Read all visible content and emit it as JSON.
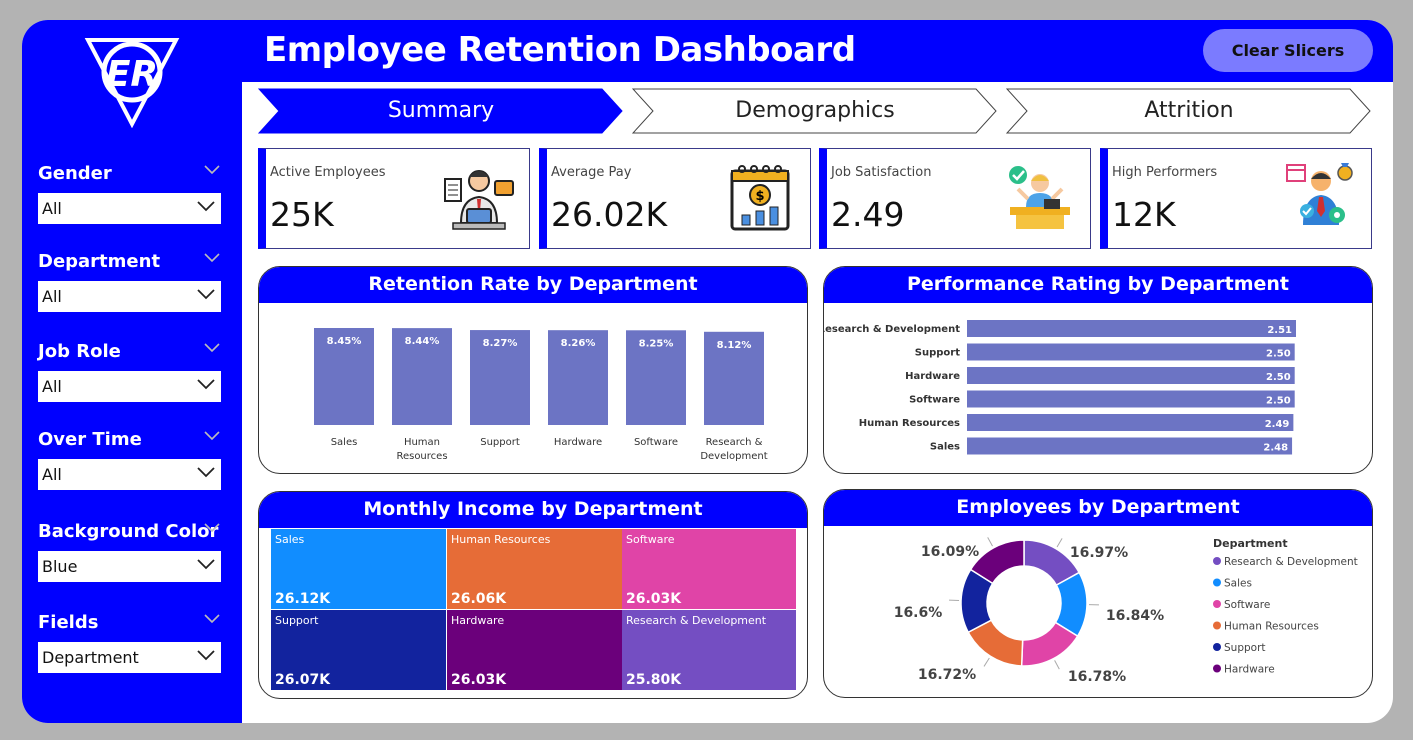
{
  "header": {
    "title": "Employee Retention Dashboard",
    "clear_label": "Clear Slicers"
  },
  "logo": {
    "letters": "ER",
    "icon": "er-shield-logo"
  },
  "colors": {
    "brand": "#0000ff",
    "bar": "#6c74c4",
    "accent_button": "#7b7bff"
  },
  "slicers": [
    {
      "label": "Gender",
      "value": "All"
    },
    {
      "label": "Department",
      "value": "All"
    },
    {
      "label": "Job Role",
      "value": "All"
    },
    {
      "label": "Over Time",
      "value": "All"
    },
    {
      "label": "Background Color",
      "value": "Blue"
    },
    {
      "label": "Fields",
      "value": "Department"
    }
  ],
  "tabs": [
    {
      "label": "Summary",
      "active": true
    },
    {
      "label": "Demographics",
      "active": false
    },
    {
      "label": "Attrition",
      "active": false
    }
  ],
  "kpis": [
    {
      "label": "Active Employees",
      "value": "25K",
      "icon": "employee-at-desk-icon"
    },
    {
      "label": "Average Pay",
      "value": "26.02K",
      "icon": "pay-calendar-icon"
    },
    {
      "label": "Job Satisfaction",
      "value": "2.49",
      "icon": "satisfied-worker-icon"
    },
    {
      "label": "High Performers",
      "value": "12K",
      "icon": "high-performer-icon"
    }
  ],
  "retention_card": {
    "title": "Retention Rate by Department"
  },
  "performance_card": {
    "title": "Performance Rating by Department"
  },
  "income_card": {
    "title": "Monthly Income by Department"
  },
  "employees_card": {
    "title": "Employees by Department",
    "legend_title": "Department"
  },
  "chart_data": [
    {
      "type": "bar",
      "title": "Retention Rate by Department",
      "categories": [
        "Sales",
        "Human Resources",
        "Support",
        "Hardware",
        "Software",
        "Research & Development"
      ],
      "values": [
        8.45,
        8.44,
        8.27,
        8.26,
        8.25,
        8.12
      ],
      "labels": [
        "8.45%",
        "8.44%",
        "8.27%",
        "8.26%",
        "8.25%",
        "8.12%"
      ]
    },
    {
      "type": "bar",
      "orientation": "horizontal",
      "title": "Performance Rating by Department",
      "categories": [
        "Research & Development",
        "Support",
        "Hardware",
        "Software",
        "Human Resources",
        "Sales"
      ],
      "values": [
        2.51,
        2.5,
        2.5,
        2.5,
        2.49,
        2.48
      ],
      "labels": [
        "2.51",
        "2.50",
        "2.50",
        "2.50",
        "2.49",
        "2.48"
      ]
    },
    {
      "type": "heatmap",
      "subtype": "treemap",
      "title": "Monthly Income by Department",
      "categories": [
        "Sales",
        "Human Resources",
        "Software",
        "Support",
        "Hardware",
        "Research & Development"
      ],
      "labels": [
        "26.12K",
        "26.06K",
        "26.03K",
        "26.07K",
        "26.03K",
        "25.80K"
      ],
      "values": [
        26.12,
        26.06,
        26.03,
        26.07,
        26.03,
        25.8
      ],
      "colors": [
        "#118dff",
        "#e66c37",
        "#e044a7",
        "#12239e",
        "#6b007b",
        "#744ec2"
      ]
    },
    {
      "type": "pie",
      "subtype": "donut",
      "title": "Employees by Department",
      "categories": [
        "Research & Development",
        "Sales",
        "Software",
        "Human Resources",
        "Support",
        "Hardware"
      ],
      "values": [
        16.97,
        16.84,
        16.78,
        16.72,
        16.6,
        16.09
      ],
      "labels": [
        "16.97%",
        "16.84%",
        "16.78%",
        "16.72%",
        "16.6%",
        "16.09%"
      ],
      "colors": [
        "#744ec2",
        "#118dff",
        "#e044a7",
        "#e66c37",
        "#12239e",
        "#6b007b"
      ]
    }
  ]
}
